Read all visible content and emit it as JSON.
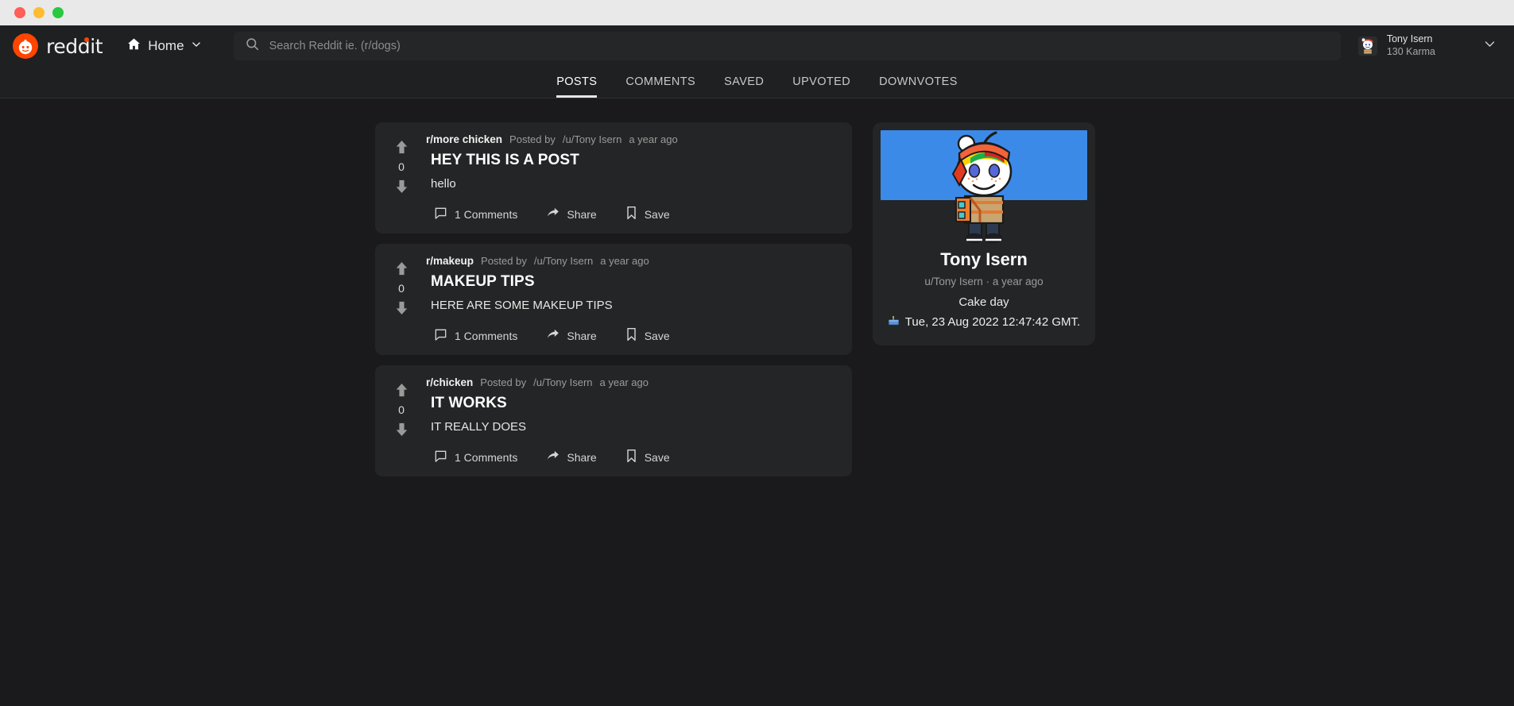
{
  "window": {
    "traffic_lights": [
      "close",
      "minimize",
      "maximize"
    ]
  },
  "navbar": {
    "brand_wordmark": "reddit",
    "brand_icon": "reddit-snoo-icon",
    "home_label": "Home",
    "home_icon": "home-icon",
    "home_chevron_icon": "chevron-down-icon",
    "search": {
      "icon": "search-icon",
      "placeholder": "Search Reddit ie. (r/dogs)",
      "value": ""
    },
    "user": {
      "avatar": "user-avatar-snoo",
      "name": "Tony Isern",
      "karma": "130 Karma",
      "chevron_icon": "chevron-down-icon"
    }
  },
  "tabs": [
    {
      "label": "POSTS",
      "active": true
    },
    {
      "label": "COMMENTS",
      "active": false
    },
    {
      "label": "SAVED",
      "active": false
    },
    {
      "label": "UPVOTED",
      "active": false
    },
    {
      "label": "DOWNVOTES",
      "active": false
    }
  ],
  "posts": [
    {
      "subreddit": "r/more chicken",
      "posted_by_label": "Posted by",
      "author": "/u/Tony Isern",
      "age": "a year ago",
      "title": "HEY THIS IS A POST",
      "body": "hello",
      "score": "0",
      "comments_label": "1 Comments",
      "share_label": "Share",
      "save_label": "Save"
    },
    {
      "subreddit": "r/makeup",
      "posted_by_label": "Posted by",
      "author": "/u/Tony Isern",
      "age": "a year ago",
      "title": "MAKEUP TIPS",
      "body": "HERE ARE SOME MAKEUP TIPS",
      "score": "0",
      "comments_label": "1 Comments",
      "share_label": "Share",
      "save_label": "Save"
    },
    {
      "subreddit": "r/chicken",
      "posted_by_label": "Posted by",
      "author": "/u/Tony Isern",
      "age": "a year ago",
      "title": "IT WORKS",
      "body": "IT REALLY DOES",
      "score": "0",
      "comments_label": "1 Comments",
      "share_label": "Share",
      "save_label": "Save"
    }
  ],
  "profile": {
    "banner_color": "#3c8ae8",
    "avatar": "profile-avatar-snoo",
    "name": "Tony Isern",
    "handle": "u/Tony Isern · a year ago",
    "cakeday_label": "Cake day",
    "cakeday_icon": "cake-icon",
    "cakeday_date": "Tue, 23 Aug 2022 12:47:42 GMT."
  },
  "colors": {
    "page_bg": "#1a1a1c",
    "nav_bg": "#1f2021",
    "card_bg": "#242526",
    "brand": "#ff4500",
    "banner": "#3c8ae8"
  }
}
